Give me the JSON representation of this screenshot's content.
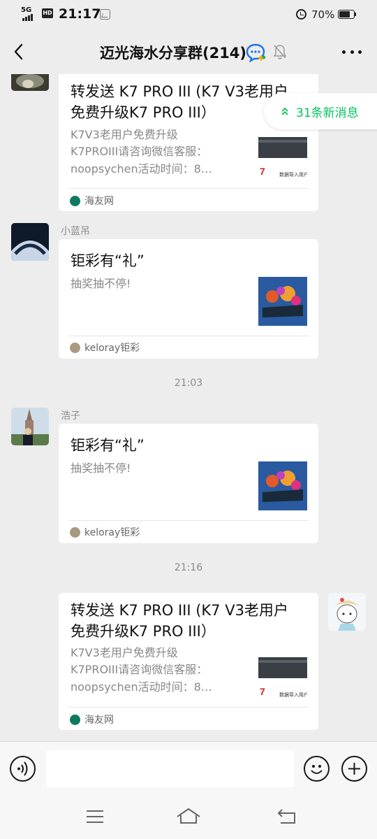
{
  "status_bar": {
    "network": "5G",
    "hd_badge": "HD",
    "time": "21:17",
    "battery_percent": "70%",
    "battery_level": 0.7
  },
  "nav": {
    "title": "迈光海水分享群(214)"
  },
  "new_messages": {
    "label": "31条新消息"
  },
  "messages": [
    {
      "sender": "",
      "title_line1": "转发送 K7 PRO III (K7 V3老用户",
      "title_line2": "免费升级K7 PRO III）",
      "desc_line1": "K7V3老用户免费升级",
      "desc_line2": "K7PROIII请咨询微信客服：",
      "desc_line3": "noopsychen活动时间：8…",
      "thumb_caption": "数据导入用户",
      "source": "海友网"
    },
    {
      "sender": "小蓝吊",
      "title_line1": "钜彩有“礼”",
      "desc_line1": "抽奖抽不停!",
      "source": "keloray钜彩"
    },
    {
      "timestamp": "21:03"
    },
    {
      "sender": "浩子",
      "title_line1": "钜彩有“礼”",
      "desc_line1": "抽奖抽不停!",
      "source": "keloray钜彩"
    },
    {
      "timestamp": "21:16"
    },
    {
      "sender": "",
      "title_line1": "转发送 K7 PRO III (K7 V3老用户",
      "title_line2": "免费升级K7 PRO III）",
      "desc_line1": "K7V3老用户免费升级",
      "desc_line2": "K7PROIII请咨询微信客服：",
      "desc_line3": "noopsychen活动时间：8…",
      "thumb_caption": "数据导入用户",
      "source": "海友网"
    }
  ],
  "colors": {
    "accent_green": "#07c160",
    "background": "#ededed"
  }
}
